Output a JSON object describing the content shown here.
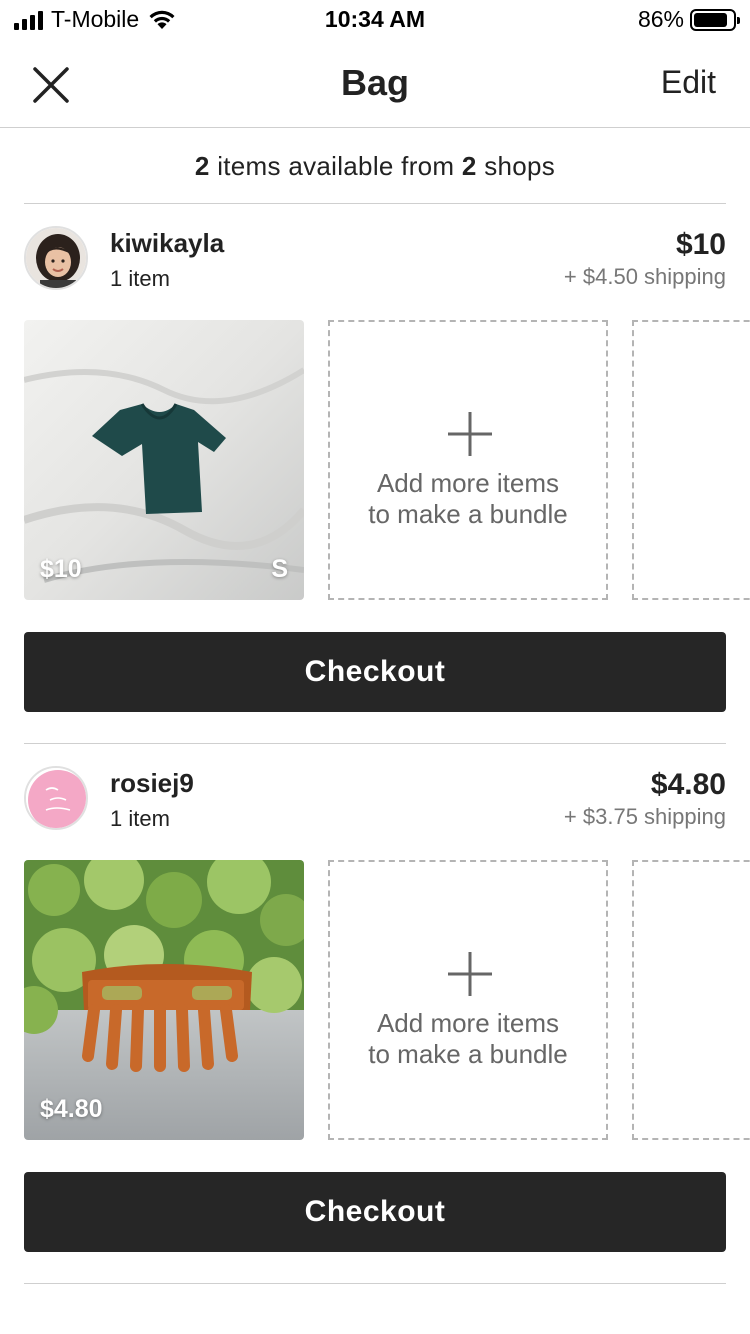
{
  "status_bar": {
    "carrier": "T-Mobile",
    "time": "10:34 AM",
    "battery_percent": "86%",
    "battery_level": 0.86
  },
  "header": {
    "title": "Bag",
    "edit_label": "Edit",
    "close_icon": "close-icon"
  },
  "summary": {
    "item_count": "2",
    "text_mid": "items available from",
    "shop_count": "2",
    "text_end": "shops"
  },
  "shops": [
    {
      "name": "kiwikayla",
      "item_count_label": "1 item",
      "total": "$10",
      "shipping": "+ $4.50 shipping",
      "items": [
        {
          "price": "$10",
          "size": "S",
          "icon": "green-tshirt-photo"
        }
      ],
      "add_more_line1": "Add more items",
      "add_more_line2": "to make a bundle",
      "checkout_label": "Checkout"
    },
    {
      "name": "rosiej9",
      "item_count_label": "1 item",
      "total": "$4.80",
      "shipping": "+ $3.75 shipping",
      "items": [
        {
          "price": "$4.80",
          "icon": "hair-claw-clip-photo"
        }
      ],
      "add_more_line1": "Add more items",
      "add_more_line2": "to make a bundle",
      "checkout_label": "Checkout"
    }
  ],
  "colors": {
    "button_bg": "#262626",
    "divider": "#cfcfcf",
    "muted_text": "#777777"
  }
}
